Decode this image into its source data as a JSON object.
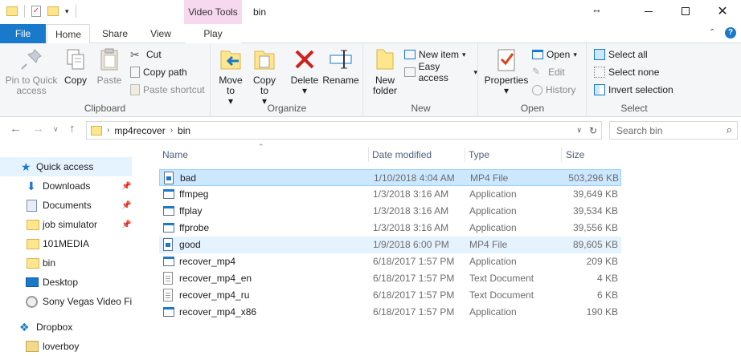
{
  "window": {
    "title": "bin",
    "contextual_tab_header": "Video Tools",
    "maximize_glyph": "↔"
  },
  "tabs": [
    "File",
    "Home",
    "Share",
    "View",
    "Play"
  ],
  "ribbon": {
    "clipboard": {
      "label": "Clipboard",
      "pin_to_quick_access": "Pin to Quick access",
      "copy": "Copy",
      "paste": "Paste",
      "cut": "Cut",
      "copy_path": "Copy path",
      "paste_shortcut": "Paste shortcut"
    },
    "organize": {
      "label": "Organize",
      "move_to": "Move to",
      "copy_to": "Copy to",
      "delete": "Delete",
      "rename": "Rename"
    },
    "new": {
      "label": "New",
      "new_folder": "New folder",
      "new_item": "New item",
      "easy_access": "Easy access"
    },
    "open": {
      "label": "Open",
      "properties": "Properties",
      "open": "Open",
      "edit": "Edit",
      "history": "History"
    },
    "select": {
      "label": "Select",
      "select_all": "Select all",
      "select_none": "Select none",
      "invert_selection": "Invert selection"
    }
  },
  "address": {
    "breadcrumb": [
      "mp4recover",
      "bin"
    ],
    "search_placeholder": "Search bin"
  },
  "navpane": [
    {
      "label": "Quick access",
      "icon": "star-icon",
      "selected": true,
      "pinned": false
    },
    {
      "label": "Downloads",
      "icon": "download-icon",
      "selected": false,
      "pinned": true
    },
    {
      "label": "Documents",
      "icon": "documents-icon",
      "selected": false,
      "pinned": true
    },
    {
      "label": "job simulator",
      "icon": "folder-icon",
      "selected": false,
      "pinned": true
    },
    {
      "label": "101MEDIA",
      "icon": "folder-icon",
      "selected": false,
      "pinned": false
    },
    {
      "label": "bin",
      "icon": "folder-icon",
      "selected": false,
      "pinned": false
    },
    {
      "label": "Desktop",
      "icon": "desktop-icon",
      "selected": false,
      "pinned": false
    },
    {
      "label": "Sony Vegas Video File",
      "icon": "disc-icon",
      "selected": false,
      "pinned": false
    },
    {
      "label": "Dropbox",
      "icon": "dropbox-icon",
      "selected": false,
      "pinned": false
    },
    {
      "label": "loverboy",
      "icon": "user-folder-icon",
      "selected": false,
      "pinned": false
    }
  ],
  "filelist": {
    "columns": {
      "name": "Name",
      "date": "Date modified",
      "type": "Type",
      "size": "Size"
    },
    "rows": [
      {
        "name": "bad",
        "date": "1/10/2018 4:04 AM",
        "type": "MP4 File",
        "size": "503,296 KB",
        "icon": "video-file-icon",
        "state": "selected"
      },
      {
        "name": "ffmpeg",
        "date": "1/3/2018 3:16 AM",
        "type": "Application",
        "size": "39,649 KB",
        "icon": "app-icon",
        "state": ""
      },
      {
        "name": "ffplay",
        "date": "1/3/2018 3:16 AM",
        "type": "Application",
        "size": "39,534 KB",
        "icon": "app-icon",
        "state": ""
      },
      {
        "name": "ffprobe",
        "date": "1/3/2018 3:16 AM",
        "type": "Application",
        "size": "39,556 KB",
        "icon": "app-icon",
        "state": ""
      },
      {
        "name": "good",
        "date": "1/9/2018 6:00 PM",
        "type": "MP4 File",
        "size": "89,605 KB",
        "icon": "video-file-icon",
        "state": "hover"
      },
      {
        "name": "recover_mp4",
        "date": "6/18/2017 1:57 PM",
        "type": "Application",
        "size": "209 KB",
        "icon": "app-icon",
        "state": ""
      },
      {
        "name": "recover_mp4_en",
        "date": "6/18/2017 1:57 PM",
        "type": "Text Document",
        "size": "4 KB",
        "icon": "text-file-icon",
        "state": ""
      },
      {
        "name": "recover_mp4_ru",
        "date": "6/18/2017 1:57 PM",
        "type": "Text Document",
        "size": "6 KB",
        "icon": "text-file-icon",
        "state": ""
      },
      {
        "name": "recover_mp4_x86",
        "date": "6/18/2017 1:57 PM",
        "type": "Application",
        "size": "190 KB",
        "icon": "app-icon",
        "state": ""
      }
    ]
  },
  "colors": {
    "accent": "#1979ca",
    "selection": "#cce8ff",
    "hover": "#e5f3ff",
    "folder": "#ffe68c"
  }
}
